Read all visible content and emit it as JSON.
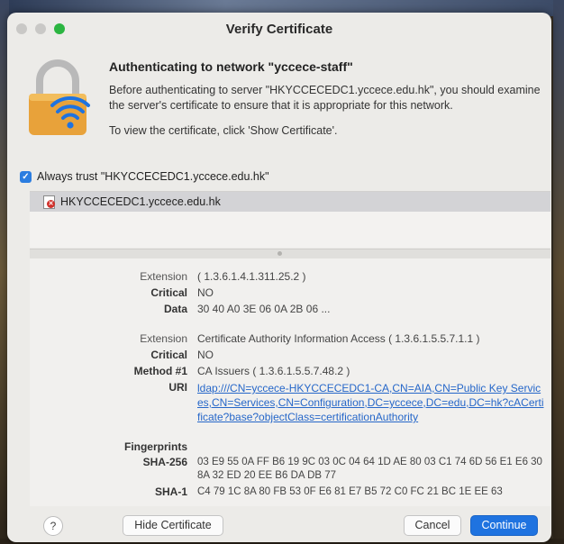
{
  "window": {
    "title": "Verify Certificate"
  },
  "header": {
    "heading": "Authenticating to network \"yccece-staff\"",
    "paragraph": "Before authenticating to server \"HKYCCECEDC1.yccece.edu.hk\", you should examine the server's certificate to ensure that it is appropriate for this network.",
    "instruction": "To view the certificate, click 'Show Certificate'."
  },
  "trust": {
    "checked": true,
    "label": "Always trust \"HKYCCECEDC1.yccece.edu.hk\""
  },
  "certificate": {
    "name": "HKYCCECEDC1.yccece.edu.hk"
  },
  "details": {
    "ext1": {
      "label": "Extension",
      "value": "( 1.3.6.1.4.1.311.25.2 )",
      "critical_label": "Critical",
      "critical": "NO",
      "data_label": "Data",
      "data": "30 40 A0 3E 06 0A 2B 06 ..."
    },
    "ext2": {
      "label": "Extension",
      "value": "Certificate Authority Information Access ( 1.3.6.1.5.5.7.1.1 )",
      "critical_label": "Critical",
      "critical": "NO",
      "method_label": "Method #1",
      "method": "CA Issuers ( 1.3.6.1.5.5.7.48.2 )",
      "uri_label": "URI",
      "uri": "ldap:///CN=yccece-HKYCCECEDC1-CA,CN=AIA,CN=Public Key Services,CN=Services,CN=Configuration,DC=yccece,DC=edu,DC=hk?cACertificate?base?objectClass=certificationAuthority"
    },
    "fingerprints": {
      "label": "Fingerprints",
      "sha256_label": "SHA-256",
      "sha256": "03 E9 55 0A FF B6 19 9C 03 0C 04 64 1D AE 80 03 C1 74 6D 56 E1 E6 30 8A 32 ED 20 EE B6 DA DB 77",
      "sha1_label": "SHA-1",
      "sha1": "C4 79 1C 8A 80 FB 53 0F E6 81 E7 B5 72 C0 FC 21 BC 1E EE 63"
    }
  },
  "footer": {
    "help": "?",
    "hide_label": "Hide Certificate",
    "cancel_label": "Cancel",
    "continue_label": "Continue"
  },
  "colors": {
    "accent": "#1f73e0",
    "link": "#2667c9",
    "zoom_light": "#2bb541",
    "error_badge": "#d0302a",
    "lock_body": "#e8a23a",
    "wifi": "#1f73e0"
  }
}
